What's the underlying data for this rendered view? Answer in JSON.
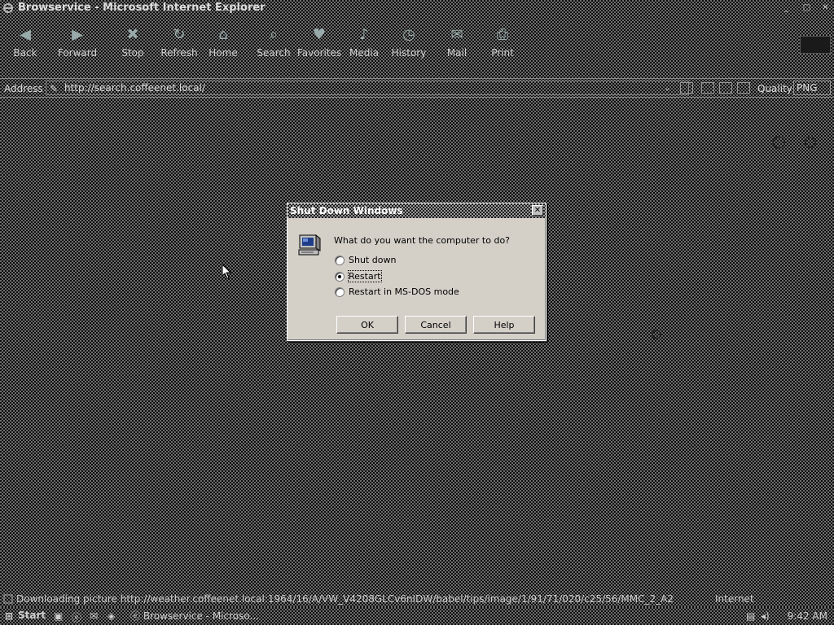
{
  "window": {
    "title": "Browservice - Microsoft Internet Explorer"
  },
  "toolbar": {
    "buttons": [
      {
        "label": "Back",
        "icon": "back-arrow-icon"
      },
      {
        "label": "Forward",
        "icon": "forward-arrow-icon"
      },
      {
        "label": "Stop",
        "icon": "stop-icon"
      },
      {
        "label": "Refresh",
        "icon": "refresh-icon"
      },
      {
        "label": "Home",
        "icon": "home-icon"
      },
      {
        "label": "Search",
        "icon": "search-icon"
      },
      {
        "label": "Favorites",
        "icon": "favorites-icon"
      },
      {
        "label": "Media",
        "icon": "media-icon"
      },
      {
        "label": "History",
        "icon": "history-icon"
      },
      {
        "label": "Mail",
        "icon": "mail-icon"
      },
      {
        "label": "Print",
        "icon": "print-icon"
      }
    ]
  },
  "addressbar": {
    "label": "Address",
    "url": "http://search.coffeenet.local/",
    "links_label": "Quality",
    "format": "PNG"
  },
  "statusbar": {
    "text": "Downloading picture http://weather.coffeenet.local:1964/16/A/VW_V4208GLCv6nIDW/babel/tips/image/1/91/71/020/c25/56/MMC_2_A2",
    "zone": "Internet"
  },
  "taskbar": {
    "start_label": "Start",
    "task_label": "Browservice - Microso...",
    "clock": "9:42 AM"
  },
  "dialog": {
    "title": "Shut Down Windows",
    "question": "What do you want the computer to do?",
    "options": [
      {
        "label": "Shut down",
        "checked": false
      },
      {
        "label": "Restart",
        "checked": true
      },
      {
        "label": "Restart in MS-DOS mode",
        "checked": false
      }
    ],
    "buttons": {
      "ok": "OK",
      "cancel": "Cancel",
      "help": "Help"
    }
  }
}
